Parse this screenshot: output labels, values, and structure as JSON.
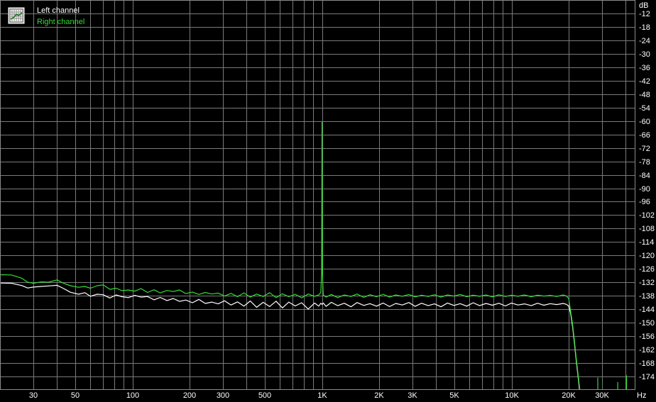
{
  "chart_data": {
    "type": "line",
    "title": "",
    "xlabel": "",
    "ylabel": "",
    "x_unit": "Hz",
    "y_unit": "dB",
    "x_scale": "log",
    "xlim": [
      20,
      45000
    ],
    "ylim": [
      -180,
      -6
    ],
    "grid": true,
    "legend_position": "top-left",
    "legend_icon": "spectrum-grid-icon",
    "x_tick_labels": [
      {
        "value": 30,
        "label": "30"
      },
      {
        "value": 50,
        "label": "50"
      },
      {
        "value": 100,
        "label": "100"
      },
      {
        "value": 200,
        "label": "200"
      },
      {
        "value": 300,
        "label": "300"
      },
      {
        "value": 500,
        "label": "500"
      },
      {
        "value": 1000,
        "label": "1K"
      },
      {
        "value": 2000,
        "label": "2K"
      },
      {
        "value": 3000,
        "label": "3K"
      },
      {
        "value": 5000,
        "label": "5K"
      },
      {
        "value": 10000,
        "label": "10K"
      },
      {
        "value": 20000,
        "label": "20K"
      },
      {
        "value": 30000,
        "label": "30K"
      }
    ],
    "y_ticks": [
      -12,
      -18,
      -24,
      -30,
      -36,
      -42,
      -48,
      -54,
      -60,
      -66,
      -72,
      -78,
      -84,
      -90,
      -96,
      -102,
      -108,
      -114,
      -120,
      -126,
      -132,
      -138,
      -144,
      -150,
      -156,
      -162,
      -168,
      -174
    ],
    "colors": {
      "background": "#000000",
      "grid": "#7a7a7a",
      "text": "#ffffff"
    },
    "series": [
      {
        "name": "Left channel",
        "color": "#ffffff",
        "points": [
          [
            20,
            -132.3
          ],
          [
            23,
            -132.4
          ],
          [
            26,
            -133.4
          ],
          [
            28,
            -134.5
          ],
          [
            30,
            -134.1
          ],
          [
            33,
            -133.8
          ],
          [
            36,
            -133.6
          ],
          [
            40,
            -133.3
          ],
          [
            43,
            -134.6
          ],
          [
            47,
            -136.4
          ],
          [
            52,
            -137.3
          ],
          [
            56,
            -136.6
          ],
          [
            60,
            -138.2
          ],
          [
            65,
            -137.3
          ],
          [
            70,
            -137.5
          ],
          [
            76,
            -139.0
          ],
          [
            82,
            -137.6
          ],
          [
            88,
            -138.4
          ],
          [
            95,
            -138.8
          ],
          [
            103,
            -137.8
          ],
          [
            111,
            -138.6
          ],
          [
            120,
            -138.3
          ],
          [
            130,
            -139.8
          ],
          [
            140,
            -138.7
          ],
          [
            152,
            -140.1
          ],
          [
            164,
            -139.2
          ],
          [
            177,
            -140.5
          ],
          [
            191,
            -139.9
          ],
          [
            207,
            -141.1
          ],
          [
            224,
            -139.6
          ],
          [
            242,
            -141.4
          ],
          [
            262,
            -140.8
          ],
          [
            283,
            -141.6
          ],
          [
            306,
            -140.2
          ],
          [
            331,
            -142.1
          ],
          [
            358,
            -140.7
          ],
          [
            387,
            -142.6
          ],
          [
            418,
            -140.3
          ],
          [
            452,
            -143.1
          ],
          [
            489,
            -140.9
          ],
          [
            529,
            -142.8
          ],
          [
            572,
            -140.4
          ],
          [
            618,
            -143.4
          ],
          [
            668,
            -140.8
          ],
          [
            722,
            -142.5
          ],
          [
            781,
            -141.1
          ],
          [
            845,
            -143.9
          ],
          [
            913,
            -141.2
          ],
          [
            960,
            -142.6
          ],
          [
            985,
            -141.3
          ],
          [
            1000,
            -141.8
          ],
          [
            1015,
            -141.2
          ],
          [
            1050,
            -142.7
          ],
          [
            1120,
            -140.9
          ],
          [
            1210,
            -142.4
          ],
          [
            1310,
            -141.3
          ],
          [
            1420,
            -142.9
          ],
          [
            1530,
            -141.0
          ],
          [
            1660,
            -142.3
          ],
          [
            1790,
            -141.5
          ],
          [
            1940,
            -142.6
          ],
          [
            2100,
            -141.2
          ],
          [
            2270,
            -142.8
          ],
          [
            2450,
            -141.4
          ],
          [
            2650,
            -142.1
          ],
          [
            2870,
            -141.0
          ],
          [
            3100,
            -142.7
          ],
          [
            3350,
            -141.3
          ],
          [
            3630,
            -142.4
          ],
          [
            3920,
            -141.6
          ],
          [
            4240,
            -142.9
          ],
          [
            4590,
            -141.2
          ],
          [
            4960,
            -142.3
          ],
          [
            5360,
            -141.5
          ],
          [
            5800,
            -142.6
          ],
          [
            6270,
            -141.1
          ],
          [
            6780,
            -142.4
          ],
          [
            7330,
            -141.4
          ],
          [
            7930,
            -142.2
          ],
          [
            8570,
            -141.3
          ],
          [
            9270,
            -142.5
          ],
          [
            10000,
            -141.2
          ],
          [
            10800,
            -142.1
          ],
          [
            11700,
            -141.6
          ],
          [
            12700,
            -142.4
          ],
          [
            13700,
            -141.3
          ],
          [
            14800,
            -142.2
          ],
          [
            16000,
            -141.5
          ],
          [
            17300,
            -141.9
          ],
          [
            18700,
            -141.4
          ],
          [
            19500,
            -141.8
          ],
          [
            20000,
            -142.6
          ],
          [
            20500,
            -146.0
          ],
          [
            21000,
            -152.0
          ],
          [
            21500,
            -160.0
          ],
          [
            22000,
            -168.0
          ],
          [
            22500,
            -175.0
          ],
          [
            22800,
            -180.0
          ]
        ]
      },
      {
        "name": "Right channel",
        "color": "#33dd33",
        "points": [
          [
            20,
            -128.6
          ],
          [
            23,
            -128.7
          ],
          [
            26,
            -130.1
          ],
          [
            28,
            -131.9
          ],
          [
            30,
            -132.4
          ],
          [
            33,
            -131.8
          ],
          [
            36,
            -131.9
          ],
          [
            40,
            -130.9
          ],
          [
            43,
            -132.3
          ],
          [
            47,
            -133.5
          ],
          [
            52,
            -134.2
          ],
          [
            56,
            -133.8
          ],
          [
            60,
            -134.6
          ],
          [
            65,
            -133.5
          ],
          [
            70,
            -133.1
          ],
          [
            76,
            -135.1
          ],
          [
            82,
            -134.6
          ],
          [
            88,
            -135.7
          ],
          [
            95,
            -135.4
          ],
          [
            103,
            -135.9
          ],
          [
            111,
            -134.8
          ],
          [
            120,
            -136.5
          ],
          [
            130,
            -135.3
          ],
          [
            140,
            -136.7
          ],
          [
            152,
            -135.6
          ],
          [
            164,
            -136.1
          ],
          [
            177,
            -135.4
          ],
          [
            191,
            -137.0
          ],
          [
            207,
            -136.3
          ],
          [
            224,
            -137.4
          ],
          [
            242,
            -136.5
          ],
          [
            262,
            -137.2
          ],
          [
            283,
            -136.8
          ],
          [
            306,
            -138.1
          ],
          [
            331,
            -136.9
          ],
          [
            358,
            -138.4
          ],
          [
            387,
            -136.7
          ],
          [
            418,
            -138.6
          ],
          [
            452,
            -137.2
          ],
          [
            489,
            -138.3
          ],
          [
            529,
            -136.6
          ],
          [
            572,
            -138.8
          ],
          [
            618,
            -137.1
          ],
          [
            668,
            -138.4
          ],
          [
            722,
            -137.3
          ],
          [
            781,
            -138.9
          ],
          [
            845,
            -137.2
          ],
          [
            913,
            -138.2
          ],
          [
            960,
            -137.6
          ],
          [
            985,
            -136.5
          ],
          [
            995,
            -128.0
          ],
          [
            1000,
            -60.5
          ],
          [
            1005,
            -128.0
          ],
          [
            1015,
            -137.6
          ],
          [
            1050,
            -138.6
          ],
          [
            1120,
            -137.4
          ],
          [
            1210,
            -138.8
          ],
          [
            1310,
            -137.6
          ],
          [
            1420,
            -138.3
          ],
          [
            1530,
            -137.2
          ],
          [
            1660,
            -138.7
          ],
          [
            1790,
            -137.5
          ],
          [
            1940,
            -138.4
          ],
          [
            2100,
            -137.3
          ],
          [
            2270,
            -138.6
          ],
          [
            2450,
            -137.6
          ],
          [
            2650,
            -138.2
          ],
          [
            2870,
            -137.4
          ],
          [
            3100,
            -138.5
          ],
          [
            3350,
            -137.7
          ],
          [
            3630,
            -138.3
          ],
          [
            3920,
            -137.5
          ],
          [
            4240,
            -138.6
          ],
          [
            4590,
            -137.6
          ],
          [
            4960,
            -138.1
          ],
          [
            5360,
            -137.4
          ],
          [
            5800,
            -138.4
          ],
          [
            6270,
            -137.7
          ],
          [
            6780,
            -138.2
          ],
          [
            7330,
            -137.6
          ],
          [
            7930,
            -138.5
          ],
          [
            8570,
            -137.5
          ],
          [
            9270,
            -138.3
          ],
          [
            10000,
            -137.7
          ],
          [
            10800,
            -138.2
          ],
          [
            11700,
            -137.6
          ],
          [
            12700,
            -138.4
          ],
          [
            13700,
            -137.7
          ],
          [
            14800,
            -138.1
          ],
          [
            16000,
            -137.8
          ],
          [
            17300,
            -138.3
          ],
          [
            18700,
            -137.6
          ],
          [
            19500,
            -138.1
          ],
          [
            20000,
            -139.2
          ],
          [
            20500,
            -145.0
          ],
          [
            21000,
            -151.0
          ],
          [
            21500,
            -159.0
          ],
          [
            22000,
            -167.0
          ],
          [
            22500,
            -174.0
          ],
          [
            22900,
            -180.0
          ]
        ]
      }
    ],
    "right_channel_spurs": [
      [
        28500,
        -174.5
      ],
      [
        36300,
        -176.5
      ],
      [
        40400,
        -173.5
      ]
    ]
  }
}
